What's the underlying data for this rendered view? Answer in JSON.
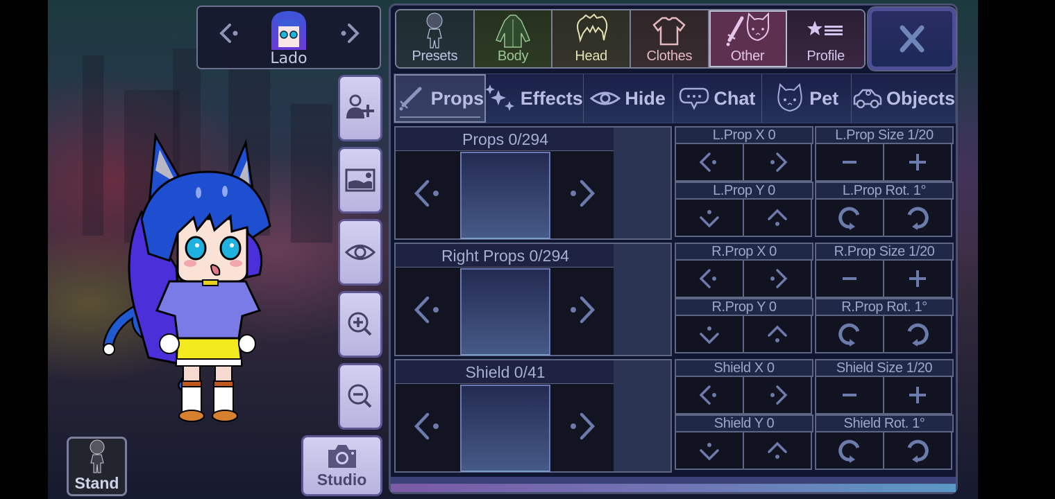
{
  "character": {
    "name": "Lado",
    "prev_icon": "chevron-left-dot-icon",
    "next_icon": "chevron-right-dot-icon"
  },
  "side_buttons": [
    {
      "id": "add-character",
      "icon": "add-person-icon"
    },
    {
      "id": "background",
      "icon": "image-icon"
    },
    {
      "id": "hide-ui",
      "icon": "eye-icon"
    },
    {
      "id": "zoom-in",
      "icon": "zoom-in-icon"
    },
    {
      "id": "zoom-out",
      "icon": "zoom-out-icon"
    }
  ],
  "studio_button": {
    "label": "Studio",
    "icon": "camera-icon"
  },
  "stand_button": {
    "label": "Stand",
    "icon": "body-silhouette-icon"
  },
  "category_tabs": [
    {
      "label": "Presets",
      "icon": "body-silhouette-icon",
      "color": "#b8c8e6"
    },
    {
      "label": "Body",
      "icon": "jacket-icon",
      "color": "#9cc794"
    },
    {
      "label": "Head",
      "icon": "hair-icon",
      "color": "#e4e2b4"
    },
    {
      "label": "Clothes",
      "icon": "shirt-icon",
      "color": "#e6b8bf"
    },
    {
      "label": "Other",
      "icon": "sword-cat-icon",
      "color": "#e4c4e8",
      "active": true
    },
    {
      "label": "Profile",
      "icon": "star-list-icon",
      "color": "#d2c6ee"
    }
  ],
  "close_button": {
    "label": "X",
    "icon": "close-icon"
  },
  "sub_tabs": [
    {
      "label": "Props",
      "icon": "sword-icon",
      "active": true
    },
    {
      "label": "Effects",
      "icon": "sparkles-icon"
    },
    {
      "label": "Hide",
      "icon": "eye-icon"
    },
    {
      "label": "Chat",
      "icon": "speech-bubble-icon"
    },
    {
      "label": "Pet",
      "icon": "cat-face-icon"
    },
    {
      "label": "Objects",
      "icon": "car-icon"
    }
  ],
  "selectors": [
    {
      "title": "Props 0/294",
      "current": 0,
      "total": 294
    },
    {
      "title": "Right Props 0/294",
      "current": 0,
      "total": 294
    },
    {
      "title": "Shield 0/41",
      "current": 0,
      "total": 41
    }
  ],
  "controls": [
    {
      "x_label": "L.Prop X 0",
      "y_label": "L.Prop Y 0",
      "size_label": "L.Prop Size 1/20",
      "rot_label": "L.Prop Rot. 1°"
    },
    {
      "x_label": "R.Prop X 0",
      "y_label": "R.Prop Y 0",
      "size_label": "R.Prop Size 1/20",
      "rot_label": "R.Prop Rot. 1°"
    },
    {
      "x_label": "Shield X 0",
      "y_label": "Shield Y 0",
      "size_label": "Shield Size 1/20",
      "rot_label": "Shield Rot. 1°"
    }
  ],
  "colors": {
    "accent_icon": "#6b7bab",
    "panel_bg": "#101631",
    "active_category": "#5c304e",
    "close_x": "#6f86b8"
  }
}
